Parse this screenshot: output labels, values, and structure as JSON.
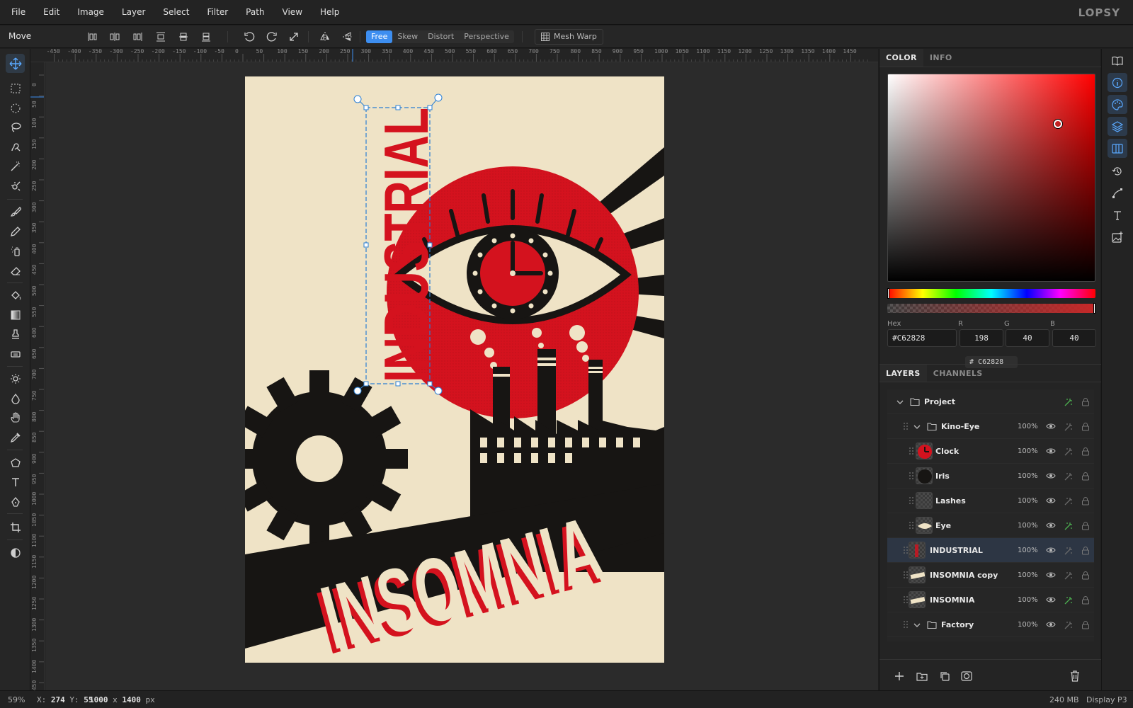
{
  "app": {
    "logo": "LOPSY"
  },
  "menu": [
    "File",
    "Edit",
    "Image",
    "Layer",
    "Select",
    "Filter",
    "Path",
    "View",
    "Help"
  ],
  "options": {
    "tool_name": "Move",
    "transform_modes": [
      "Free",
      "Skew",
      "Distort",
      "Perspective"
    ],
    "active_mode": "Free",
    "mesh_warp_label": "Mesh Warp"
  },
  "ruler": {
    "top_labels": [
      "-450",
      "-400",
      "-350",
      "-300",
      "-250",
      "-200",
      "-150",
      "-100",
      "-50",
      "0",
      "50",
      "100",
      "150",
      "200",
      "250",
      "300",
      "350",
      "400",
      "450",
      "500",
      "550",
      "600",
      "650",
      "700",
      "750",
      "800",
      "850",
      "900",
      "950",
      "1000",
      "1050",
      "1100",
      "1150",
      "1200",
      "1250",
      "1300",
      "1350",
      "1400",
      "1450"
    ],
    "left_labels": [
      "0",
      "50",
      "100",
      "150",
      "200",
      "250",
      "300",
      "350",
      "400",
      "450",
      "500",
      "550",
      "600",
      "650",
      "700",
      "750",
      "800",
      "850",
      "900",
      "950",
      "1000",
      "1050",
      "1100",
      "1150",
      "1200",
      "1250",
      "1300",
      "1350",
      "1400",
      "1450"
    ]
  },
  "artwork": {
    "vertical_text": "INDUSTRIAL",
    "banner_text": "INSOMNIA",
    "colors": {
      "cream": "#efe3c6",
      "red": "#d4121e",
      "black": "#171513"
    }
  },
  "color_panel": {
    "tabs": [
      "COLOR",
      "INFO"
    ],
    "active_tab": "COLOR",
    "labels": {
      "hex": "Hex",
      "r": "R",
      "g": "G",
      "b": "B"
    },
    "hex": "#C62828",
    "r": "198",
    "g": "40",
    "b": "40",
    "chip_hash": "#",
    "chip_value": "C62828",
    "hue_position": 0.0,
    "alpha": 1.0
  },
  "layers_panel": {
    "tabs": [
      "LAYERS",
      "CHANNELS"
    ],
    "active_tab": "LAYERS",
    "layers": [
      {
        "name": "Project",
        "type": "group",
        "opacity": "",
        "fx_active": true
      },
      {
        "name": "Kino-Eye",
        "type": "group",
        "opacity": "100%",
        "fx_active": false
      },
      {
        "name": "Clock",
        "type": "layer",
        "opacity": "100%",
        "fx_active": false
      },
      {
        "name": "Iris",
        "type": "layer",
        "opacity": "100%",
        "fx_active": false
      },
      {
        "name": "Lashes",
        "type": "layer",
        "opacity": "100%",
        "fx_active": false
      },
      {
        "name": "Eye",
        "type": "layer",
        "opacity": "100%",
        "fx_active": true
      },
      {
        "name": "INDUSTRIAL",
        "type": "layer",
        "opacity": "100%",
        "fx_active": false,
        "selected": true
      },
      {
        "name": "INSOMNIA copy",
        "type": "layer",
        "opacity": "100%",
        "fx_active": false
      },
      {
        "name": "INSOMNIA",
        "type": "layer",
        "opacity": "100%",
        "fx_active": true
      },
      {
        "name": "Factory",
        "type": "group",
        "opacity": "100%",
        "fx_active": false
      }
    ]
  },
  "status": {
    "zoom": "59%",
    "x_label": "X:",
    "x_value": "274",
    "y_label": "Y:",
    "y_value": "55",
    "doc_w": "1000",
    "doc_x": "x",
    "doc_h": "1400",
    "doc_unit": "px",
    "memory": "240 MB",
    "color_profile": "Display P3"
  }
}
